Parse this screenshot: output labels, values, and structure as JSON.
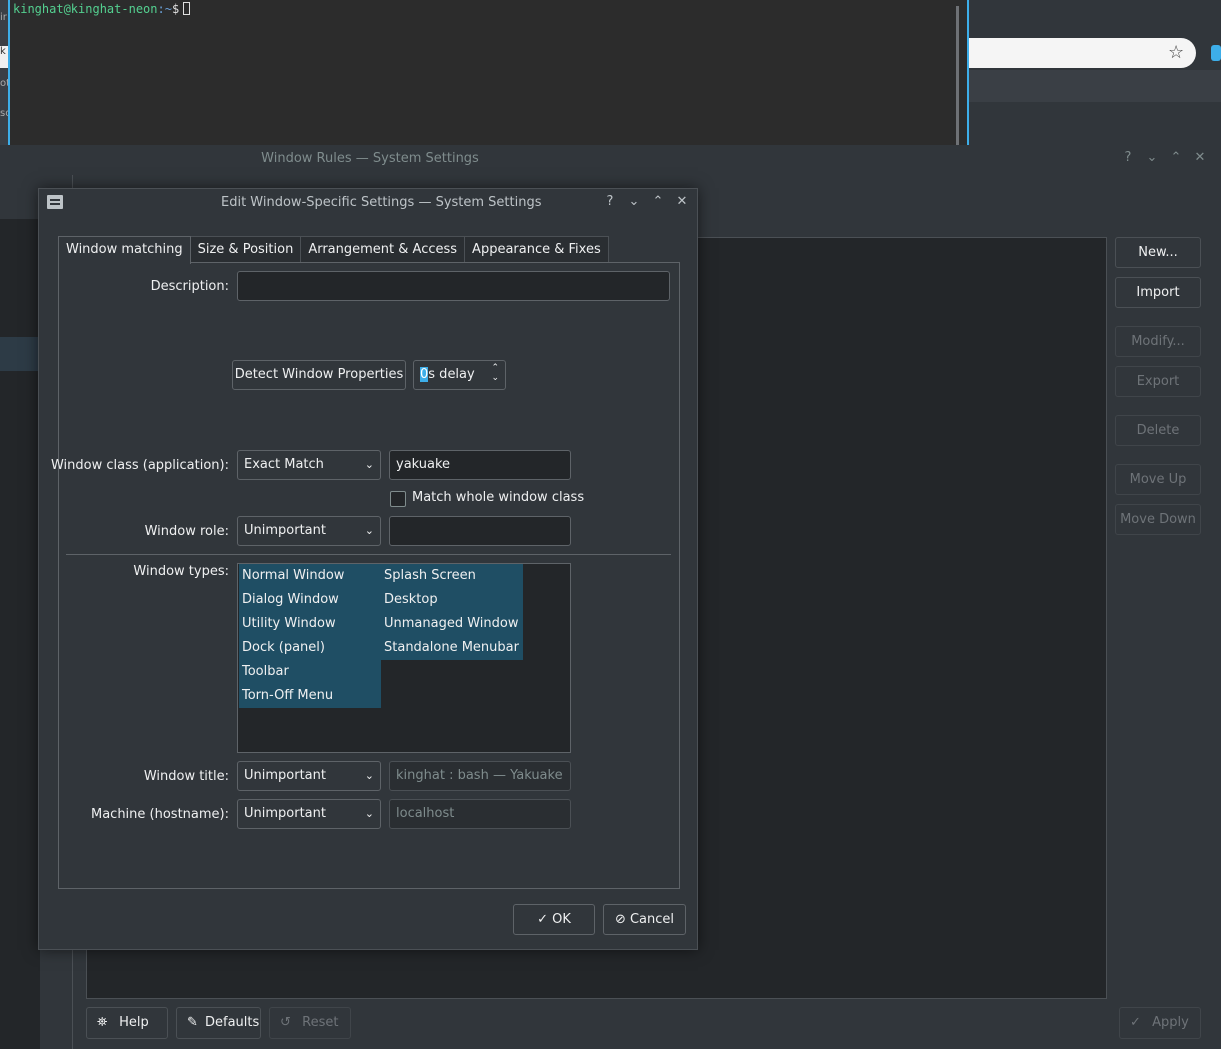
{
  "terminal": {
    "user_host": "kinghat@kinghat-neon",
    "path": ":~",
    "prompt": "$"
  },
  "rules_window": {
    "title": "Window Rules — System Settings",
    "side_buttons": {
      "new": "New...",
      "import": "Import",
      "modify": "Modify...",
      "export": "Export",
      "delete": "Delete",
      "move_up": "Move Up",
      "move_down": "Move Down"
    },
    "bottom_buttons": {
      "help": "Help",
      "defaults": "Defaults",
      "reset": "Reset",
      "apply": "Apply"
    }
  },
  "dialog": {
    "title": "Edit Window-Specific Settings — System Settings",
    "tabs": [
      "Window matching",
      "Size & Position",
      "Arrangement & Access",
      "Appearance & Fixes"
    ],
    "description_label": "Description:",
    "description_value": "",
    "detect_button": "Detect Window Properties",
    "delay": {
      "highlight": "0",
      "suffix": "s delay"
    },
    "window_class": {
      "label": "Window class (application):",
      "match": "Exact Match",
      "value": "yakuake",
      "whole_class_label": "Match whole window class"
    },
    "window_role": {
      "label": "Window role:",
      "match": "Unimportant",
      "value": ""
    },
    "window_types": {
      "label": "Window types:",
      "column1": [
        "Normal Window",
        "Dialog Window",
        "Utility Window",
        "Dock (panel)",
        "Toolbar",
        "Torn-Off Menu"
      ],
      "column2": [
        "Splash Screen",
        "Desktop",
        "Unmanaged Window",
        "Standalone Menubar"
      ]
    },
    "window_title": {
      "label": "Window title:",
      "match": "Unimportant",
      "placeholder": "kinghat : bash — Yakuake"
    },
    "machine": {
      "label": "Machine (hostname):",
      "match": "Unimportant",
      "placeholder": "localhost"
    },
    "ok": "OK",
    "cancel": "Cancel"
  }
}
